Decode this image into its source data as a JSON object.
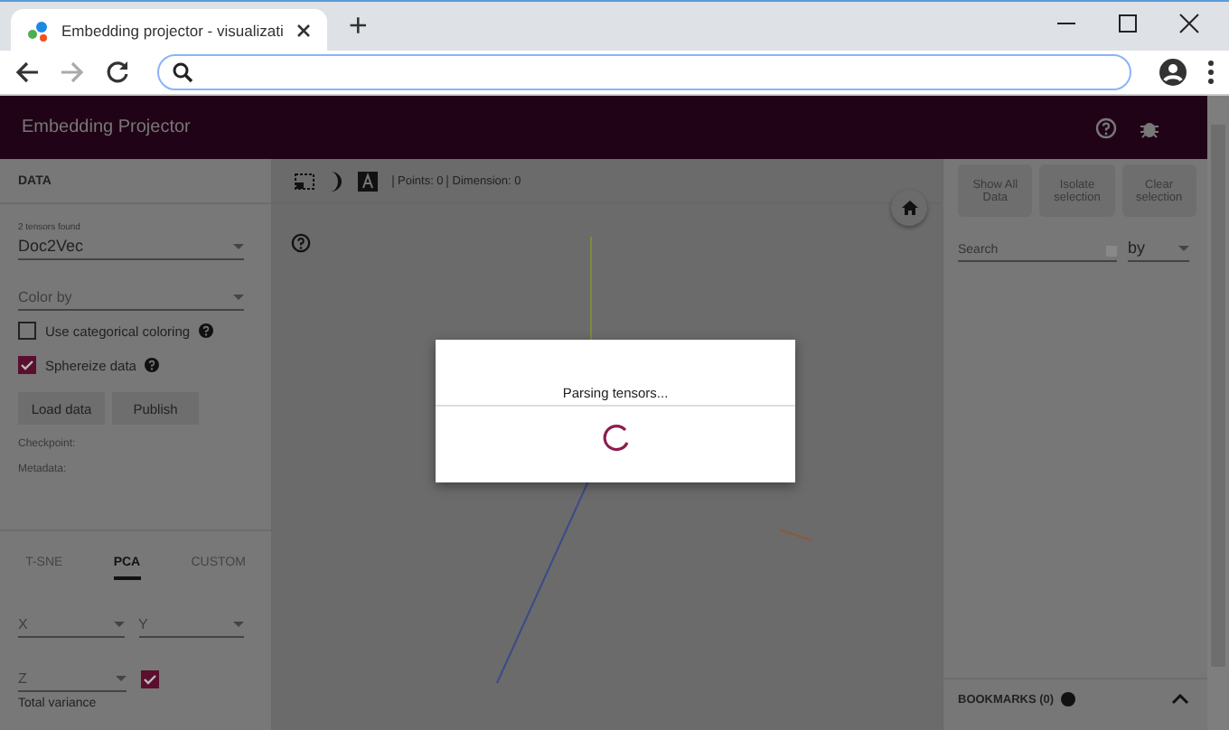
{
  "browser": {
    "tab_title": "Embedding projector - visualizati",
    "new_tab": "+"
  },
  "app": {
    "title": "Embedding Projector"
  },
  "data_panel": {
    "title": "DATA",
    "tensor_label": "2 tensors found",
    "tensor": "Doc2Vec",
    "color_by": {
      "placeholder": "Color by"
    },
    "checkboxes": [
      {
        "label": "Use categorical coloring",
        "checked": false
      },
      {
        "label": "Sphereize data",
        "checked": true
      }
    ],
    "buttons": [
      "Load data",
      "Publish"
    ],
    "info": [
      "Checkpoint:",
      "Metadata:"
    ]
  },
  "projection_tabs": [
    {
      "label": "T-SNE",
      "selected": false
    },
    {
      "label": "PCA",
      "selected": true
    },
    {
      "label": "CUSTOM",
      "selected": false
    }
  ],
  "pca": {
    "selects": [
      "X",
      "Y",
      "Z"
    ],
    "z_checked": true,
    "total_variance": "Total variance"
  },
  "view": {
    "points": "Points: 0",
    "dimension": "Dimension: 0"
  },
  "inspector": {
    "buttons": [
      "Show All Data",
      "Isolate selection",
      "Clear selection"
    ],
    "search": {
      "placeholder": "Search"
    },
    "by": "by",
    "bookmarks": "BOOKMARKS (0)"
  },
  "dialog": {
    "message": "Parsing tensors..."
  }
}
